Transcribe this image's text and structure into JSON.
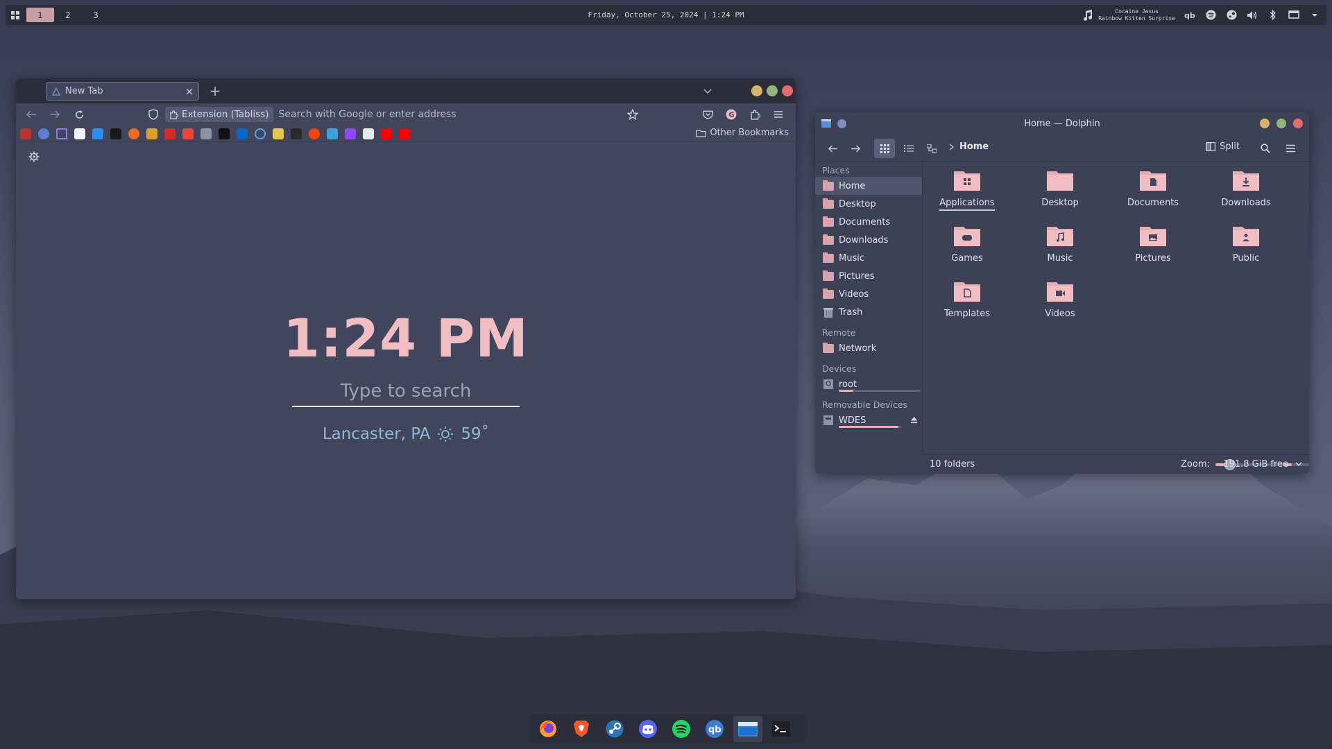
{
  "panel": {
    "workspaces": [
      "1",
      "2",
      "3"
    ],
    "active_workspace": "1",
    "clock": "Friday, October 25, 2024 | 1:24 PM",
    "now_playing": {
      "title": "Cocaine Jesus",
      "artist": "Rainbow Kitten Surprise"
    },
    "tray_icons": [
      "music-note-icon",
      "qbittorrent-icon",
      "spotify-icon",
      "steam-icon",
      "volume-icon",
      "bluetooth-icon",
      "display-icon",
      "chevron-down-icon"
    ]
  },
  "browser": {
    "tab_title": "New Tab",
    "new_tab": "+",
    "url_extension_chip": "Extension (Tabliss)",
    "url_placeholder": "Search with Google or enter address",
    "other_bookmarks": "Other Bookmarks",
    "bookmark_count": 22,
    "tabliss": {
      "time": "1:24 PM",
      "search_placeholder": "Type to search",
      "location": "Lancaster, PA",
      "temperature": "59˚"
    }
  },
  "dolphin": {
    "title": "Home — Dolphin",
    "breadcrumb": "Home",
    "split_label": "Split",
    "sidebar": {
      "places_heading": "Places",
      "places": [
        {
          "label": "Home",
          "icon": "home-icon"
        },
        {
          "label": "Desktop",
          "icon": "desktop-folder-icon"
        },
        {
          "label": "Documents",
          "icon": "documents-folder-icon"
        },
        {
          "label": "Downloads",
          "icon": "downloads-folder-icon"
        },
        {
          "label": "Music",
          "icon": "music-folder-icon"
        },
        {
          "label": "Pictures",
          "icon": "pictures-folder-icon"
        },
        {
          "label": "Videos",
          "icon": "videos-folder-icon"
        },
        {
          "label": "Trash",
          "icon": "trash-icon"
        }
      ],
      "remote_heading": "Remote",
      "remote": [
        {
          "label": "Network",
          "icon": "network-icon"
        }
      ],
      "devices_heading": "Devices",
      "devices": [
        {
          "label": "root",
          "icon": "drive-icon",
          "usage": 0.18
        }
      ],
      "removable_heading": "Removable Devices",
      "removable": [
        {
          "label": "WDES",
          "icon": "usb-drive-icon",
          "usage": 0.95
        }
      ]
    },
    "folders": [
      "Applications",
      "Desktop",
      "Documents",
      "Downloads",
      "Games",
      "Music",
      "Pictures",
      "Public",
      "Templates",
      "Videos"
    ],
    "status": {
      "count": "10 folders",
      "zoom_label": "Zoom:",
      "zoom_level": 0.18,
      "free_fraction": 0.22,
      "free_space": "191.8 GiB free"
    }
  },
  "dock": {
    "apps": [
      "firefox-icon",
      "brave-icon",
      "steam-icon",
      "discord-icon",
      "spotify-icon",
      "qbittorrent-icon",
      "dolphin-icon",
      "terminal-icon"
    ],
    "active_app": "dolphin-icon"
  },
  "colors": {
    "accent_pink": "#f0bdc3",
    "folder_pink": "#d6a4aa",
    "panel_bg": "#2b2d3a",
    "window_bg": "#42465c",
    "weather_blue": "#8fb7d6",
    "close_red": "#e56b72",
    "max_green": "#8db87a",
    "min_yellow": "#d6b46a"
  }
}
